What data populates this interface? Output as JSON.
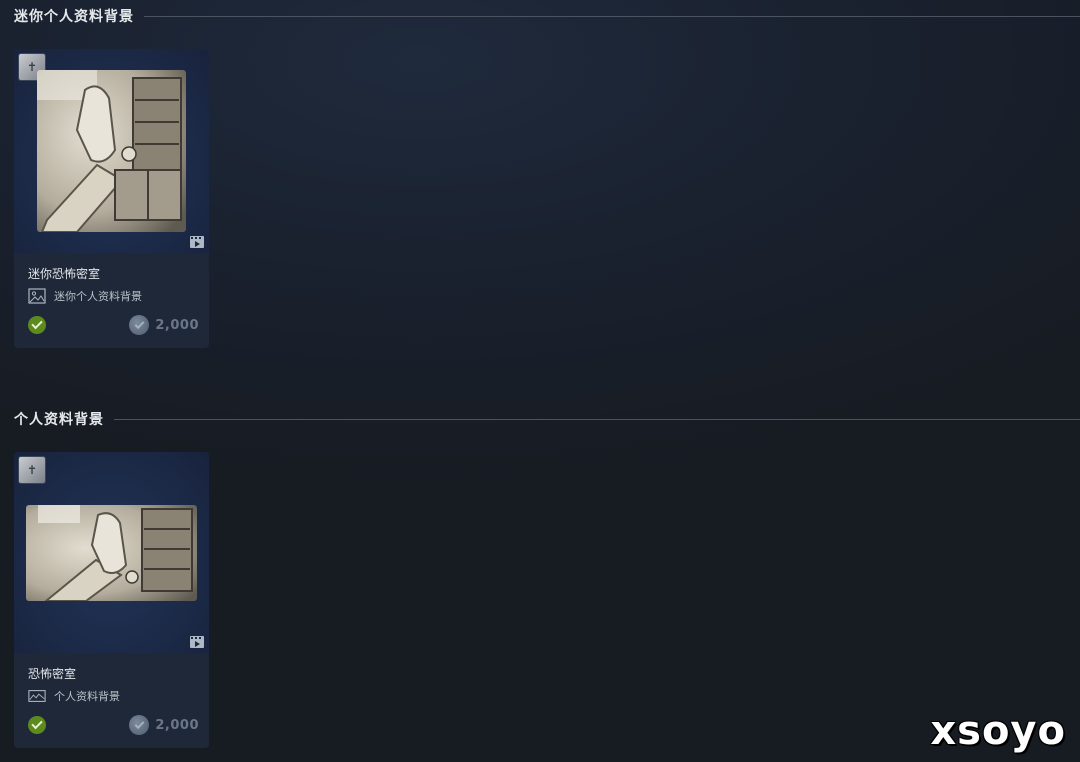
{
  "sections": [
    {
      "title": "迷你个人资料背景",
      "item": {
        "name": "迷你恐怖密室",
        "type_label": "迷你个人资料背景",
        "type_icon": "image-icon",
        "price": "2,000",
        "owned": true
      }
    },
    {
      "title": "个人资料背景",
      "item": {
        "name": "恐怖密室",
        "type_label": "个人资料背景",
        "type_icon": "landscape-image-icon",
        "price": "2,000",
        "owned": true
      }
    }
  ],
  "watermark": "xsoyo",
  "colors": {
    "owned": "#5c8a1e",
    "card_background": "#1e2838",
    "price_text": "#6b7788"
  }
}
